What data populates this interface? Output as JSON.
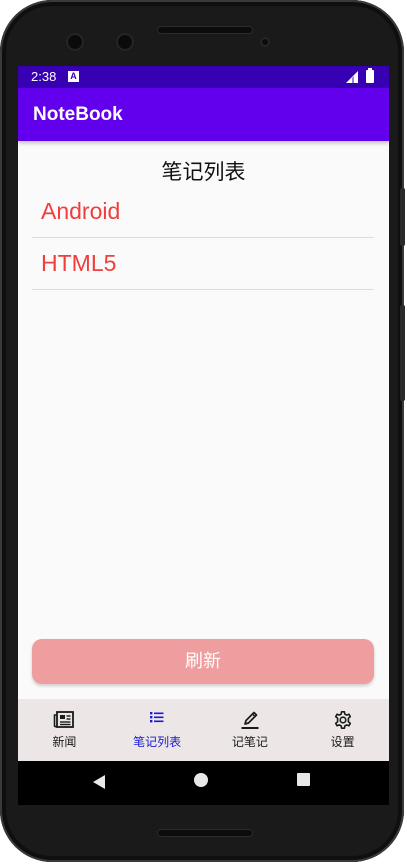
{
  "status_bar": {
    "time": "2:38",
    "notification_glyph": "A"
  },
  "app_bar": {
    "title": "NoteBook"
  },
  "page": {
    "title": "笔记列表"
  },
  "notes": [
    {
      "title": "Android"
    },
    {
      "title": "HTML5"
    }
  ],
  "refresh_button": {
    "label": "刷新"
  },
  "bottom_nav": {
    "items": [
      {
        "label": "新闻",
        "icon": "newspaper-icon",
        "active": false
      },
      {
        "label": "笔记列表",
        "icon": "list-icon",
        "active": true
      },
      {
        "label": "记笔记",
        "icon": "pen-icon",
        "active": false
      },
      {
        "label": "设置",
        "icon": "gear-icon",
        "active": false
      }
    ]
  },
  "colors": {
    "app_bar": "#6200ee",
    "status_bar": "#3700b3",
    "note_text": "#f03e3e",
    "refresh_button": "#ee9e9e",
    "nav_active": "#1a1ad4",
    "bottom_nav_bg": "#ece7e6"
  }
}
